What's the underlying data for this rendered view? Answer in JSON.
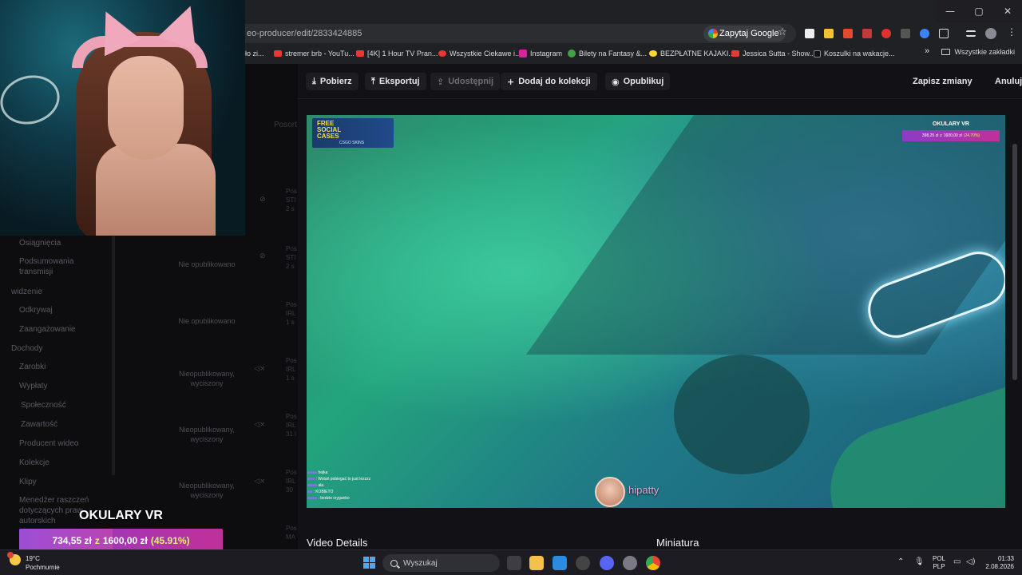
{
  "browser": {
    "url_fragment": "eo-producer/edit/2833424885",
    "ask_google": "Zapytaj Google",
    "bookmarks": [
      {
        "label": "ło zi...",
        "color": "#e53935"
      },
      {
        "label": "stremer brb - YouTu...",
        "color": "#e53935"
      },
      {
        "label": "[4K] 1 Hour TV Pran...",
        "color": "#e53935"
      },
      {
        "label": "Wszystkie Ciekawe i...",
        "color": "#e53935"
      },
      {
        "label": "Instagram",
        "color": "#d6249f"
      },
      {
        "label": "Bilety na Fantasy &...",
        "color": "#43a047"
      },
      {
        "label": "BEZPŁATNE KAJAKI...",
        "color": "#fdd835"
      },
      {
        "label": "Jessica Sutta - Show...",
        "color": "#e53935"
      },
      {
        "label": "Koszulki na wakacje...",
        "color": "#111111"
      }
    ],
    "all_bookmarks": "Wszystkie zakładki"
  },
  "sidebar": {
    "items": [
      "Osiągnięcia",
      "Podsumowania",
      "transmisji",
      "widzenie",
      "Odkrywaj",
      "Zaangażowanie",
      "Dochody",
      "Zarobki",
      "Wypłaty",
      "Społeczność",
      "Zawartość",
      "Producent wideo",
      "Kolekcje",
      "Klipy",
      "Menedżer raszczeń",
      "dotyczących praw",
      "autorskich"
    ]
  },
  "list": {
    "sort_label": "Posort",
    "rows": [
      {
        "status": "",
        "title": "Pos STI 2 s"
      },
      {
        "status": "Nie opublikowano",
        "title": "Pos STI 2 s"
      },
      {
        "status": "Nie opublikowano",
        "title": "Pos IRL 1 s"
      },
      {
        "status": "Nieopublikowany, wyciszony",
        "title": "Pos IRL 1 s"
      },
      {
        "status": "Nieopublikowany, wyciszony",
        "title": "Pos IRL 31 l"
      },
      {
        "status": "Nieopublikowany, wyciszony",
        "title": "Pos IRL 30"
      },
      {
        "status": "",
        "title": "Pos MA"
      }
    ]
  },
  "overlay_goal": {
    "title": "OKULARY VR",
    "current": "734,55 zł",
    "sep": "z",
    "target": "1600,00 zł",
    "percent": "(45.91%)",
    "fraction": 0.4591
  },
  "toolbar": {
    "download": "Pobierz",
    "export": "Eksportuj",
    "share": "Udostępnij",
    "add_collection": "Dodaj do kolekcji",
    "publish": "Opublikuj",
    "save": "Zapisz zmiany",
    "cancel": "Anuluj"
  },
  "video": {
    "badge_line1": "FREE",
    "badge_line2": "SOCIAL",
    "badge_line3": "CASES",
    "badge_sub": "CSGO SKINS",
    "goal_title": "OKULARY VR",
    "goal_current": "398,25 zł",
    "goal_sep": "z",
    "goal_target": "1600,00 zł",
    "goal_percent": "(24.70%)",
    "chat": [
      {
        "nick": "",
        "msg": "hejka"
      },
      {
        "nick": "",
        "msg": ": Wstań pobiegać to just lezzzz"
      },
      {
        "nick": "",
        "msg": "ała"
      },
      {
        "nick": "",
        "msg": ": KOBIETO"
      },
      {
        "nick": "",
        "msg": ": bedzie rzyganko"
      }
    ],
    "streamer_handle": "hipatty"
  },
  "sections": {
    "details": "Video Details",
    "thumbnail": "Miniatura"
  },
  "taskbar": {
    "temp": "19°C",
    "weather": "Pochmurnie",
    "search": "Wyszukaj",
    "lang1": "POL",
    "lang2": "PLP",
    "time": "01:33",
    "date": "2.08.2026"
  }
}
